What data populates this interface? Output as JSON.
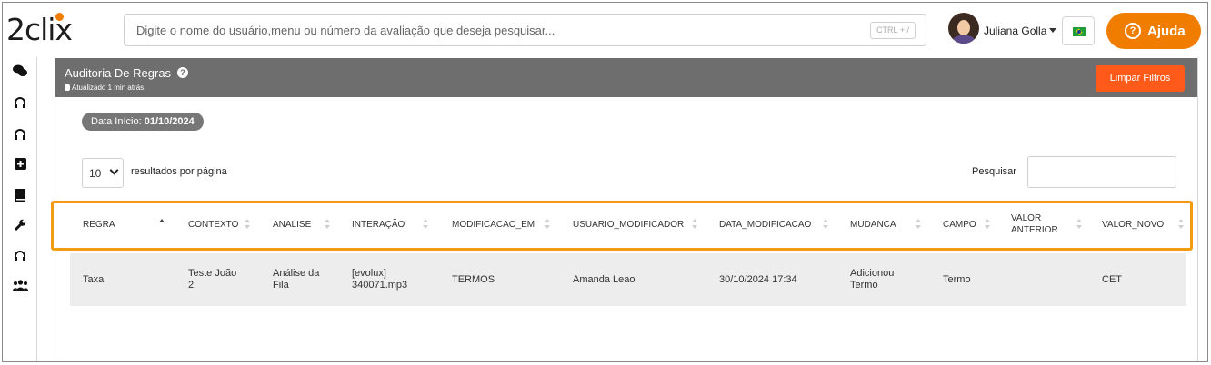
{
  "header": {
    "logo_text": "2clix",
    "search_placeholder": "Digite o nome do usuário,menu ou número da avaliação que deseja pesquisar...",
    "search_shortcut": "CTRL + /",
    "user_name": "Juliana Golla",
    "help_label": "Ajuda",
    "help_symbol": "?",
    "accent_color": "#f07d00"
  },
  "sidebar": {
    "icons": [
      "chat-icon",
      "headset-icon",
      "headset-icon",
      "plus-square-icon",
      "book-icon",
      "wrench-icon",
      "headset-icon",
      "users-icon"
    ]
  },
  "panel": {
    "title": "Auditoria De Regras",
    "help_symbol": "?",
    "updated": "Atualizado 1 min atrás.",
    "clear_filters": "Limpar Filtros",
    "date_label": "Data Início:",
    "date_value": "01/10/2024",
    "page_length": "10",
    "page_length_label": "resultados por página",
    "filter_label": "Pesquisar",
    "filter_value": ""
  },
  "table": {
    "columns": [
      "REGRA",
      "CONTEXTO",
      "ANALISE",
      "INTERAÇÃO",
      "MODIFICACAO_EM",
      "USUARIO_MODIFICADOR",
      "DATA_MODIFICACAO",
      "MUDANCA",
      "CAMPO",
      "VALOR\nANTERIOR",
      "VALOR_NOVO"
    ],
    "sorted_column": "REGRA",
    "sort_direction": "asc",
    "rows": [
      {
        "regra": "Taxa",
        "contexto": "Teste João\n2",
        "analise": "Análise da\nFila",
        "interacao": "[evolux]\n340071.mp3",
        "modificacao_em": "TERMOS",
        "usuario_modificador": "Amanda Leao",
        "data_modificacao": "30/10/2024 17:34",
        "mudanca": "Adicionou\nTermo",
        "campo": "Termo",
        "valor_anterior": "",
        "valor_novo": "CET"
      }
    ],
    "highlight_color": "#f39c12"
  }
}
